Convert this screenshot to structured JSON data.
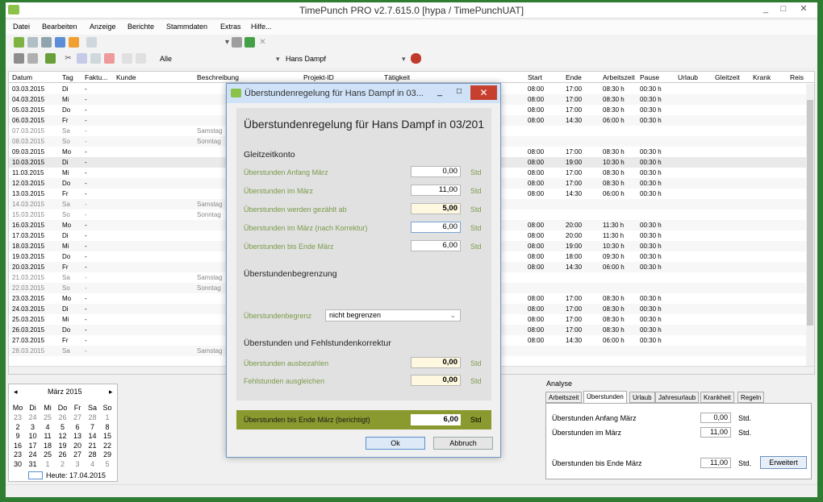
{
  "window": {
    "title": "TimePunch PRO v2.7.615.0 [hypa / TimePunchUAT]",
    "min": "_",
    "max": "□",
    "close": "✕"
  },
  "menu": [
    "Datei",
    "Bearbeiten",
    "Anzeige",
    "Berichte",
    "Stammdaten",
    "Extras",
    "Hilfe..."
  ],
  "toolbar2": {
    "filter": "Alle",
    "user": "Hans Dampf"
  },
  "grid": {
    "headers": [
      "Datum",
      "Tag",
      "Faktu...",
      "Kunde",
      "Beschreibung",
      "Projekt-ID",
      "Tätigkeit",
      "Start",
      "Ende",
      "Arbeitszeit",
      "Pause",
      "Urlaub",
      "Gleitzeit",
      "Krank",
      "Reis"
    ],
    "rows": [
      [
        "03.03.2015",
        "Di",
        "-",
        "",
        "",
        "08:00",
        "17:00",
        "08:30 h",
        "00:30 h"
      ],
      [
        "04.03.2015",
        "Mi",
        "-",
        "",
        "",
        "08:00",
        "17:00",
        "08:30 h",
        "00:30 h"
      ],
      [
        "05.03.2015",
        "Do",
        "-",
        "",
        "",
        "08:00",
        "17:00",
        "08:30 h",
        "00:30 h"
      ],
      [
        "06.03.2015",
        "Fr",
        "-",
        "",
        "",
        "08:00",
        "14:30",
        "06:00 h",
        "00:30 h"
      ],
      [
        "07.03.2015",
        "Sa",
        "-",
        "",
        "Samstag",
        "",
        "",
        "",
        ""
      ],
      [
        "08.03.2015",
        "So",
        "-",
        "",
        "Sonntag",
        "",
        "",
        "",
        ""
      ],
      [
        "09.03.2015",
        "Mo",
        "-",
        "",
        "",
        "08:00",
        "17:00",
        "08:30 h",
        "00:30 h"
      ],
      [
        "10.03.2015",
        "Di",
        "-",
        "",
        "",
        "08:00",
        "19:00",
        "10:30 h",
        "00:30 h"
      ],
      [
        "11.03.2015",
        "Mi",
        "-",
        "",
        "",
        "08:00",
        "17:00",
        "08:30 h",
        "00:30 h"
      ],
      [
        "12.03.2015",
        "Do",
        "-",
        "",
        "",
        "08:00",
        "17:00",
        "08:30 h",
        "00:30 h"
      ],
      [
        "13.03.2015",
        "Fr",
        "-",
        "",
        "",
        "08:00",
        "14:30",
        "06:00 h",
        "00:30 h"
      ],
      [
        "14.03.2015",
        "Sa",
        "-",
        "",
        "Samstag",
        "",
        "",
        "",
        ""
      ],
      [
        "15.03.2015",
        "So",
        "-",
        "",
        "Sonntag",
        "",
        "",
        "",
        ""
      ],
      [
        "16.03.2015",
        "Mo",
        "-",
        "",
        "",
        "08:00",
        "20:00",
        "11:30 h",
        "00:30 h"
      ],
      [
        "17.03.2015",
        "Di",
        "-",
        "",
        "",
        "08:00",
        "20:00",
        "11:30 h",
        "00:30 h"
      ],
      [
        "18.03.2015",
        "Mi",
        "-",
        "",
        "",
        "08:00",
        "19:00",
        "10:30 h",
        "00:30 h"
      ],
      [
        "19.03.2015",
        "Do",
        "-",
        "",
        "",
        "08:00",
        "18:00",
        "09:30 h",
        "00:30 h"
      ],
      [
        "20.03.2015",
        "Fr",
        "-",
        "",
        "",
        "08:00",
        "14:30",
        "06:00 h",
        "00:30 h"
      ],
      [
        "21.03.2015",
        "Sa",
        "-",
        "",
        "Samstag",
        "",
        "",
        "",
        ""
      ],
      [
        "22.03.2015",
        "So",
        "-",
        "",
        "Sonntag",
        "",
        "",
        "",
        ""
      ],
      [
        "23.03.2015",
        "Mo",
        "-",
        "",
        "",
        "08:00",
        "17:00",
        "08:30 h",
        "00:30 h"
      ],
      [
        "24.03.2015",
        "Di",
        "-",
        "",
        "",
        "08:00",
        "17:00",
        "08:30 h",
        "00:30 h"
      ],
      [
        "25.03.2015",
        "Mi",
        "-",
        "",
        "",
        "08:00",
        "17:00",
        "08:30 h",
        "00:30 h"
      ],
      [
        "26.03.2015",
        "Do",
        "-",
        "",
        "",
        "08:00",
        "17:00",
        "08:30 h",
        "00:30 h"
      ],
      [
        "27.03.2015",
        "Fr",
        "-",
        "",
        "",
        "08:00",
        "14:30",
        "06:00 h",
        "00:30 h"
      ],
      [
        "28.03.2015",
        "Sa",
        "-",
        "",
        "Samstag",
        "",
        "",
        "",
        ""
      ]
    ]
  },
  "calendar": {
    "title": "März 2015",
    "prev": "◂",
    "next": "▸",
    "weekdays": [
      "Mo",
      "Di",
      "Mi",
      "Do",
      "Fr",
      "Sa",
      "So"
    ],
    "weeks": [
      [
        "23",
        "24",
        "25",
        "26",
        "27",
        "28",
        "1"
      ],
      [
        "2",
        "3",
        "4",
        "5",
        "6",
        "7",
        "8"
      ],
      [
        "9",
        "10",
        "11",
        "12",
        "13",
        "14",
        "15"
      ],
      [
        "16",
        "17",
        "18",
        "19",
        "20",
        "21",
        "22"
      ],
      [
        "23",
        "24",
        "25",
        "26",
        "27",
        "28",
        "29"
      ],
      [
        "30",
        "31",
        "1",
        "2",
        "3",
        "4",
        "5"
      ]
    ],
    "today": "Heute: 17.04.2015"
  },
  "analyse": {
    "label": "Analyse",
    "tabs": [
      "Arbeitszeit",
      "Überstunden",
      "Urlaub",
      "Jahresurlaub",
      "Krankheit",
      "Regeln"
    ],
    "rows": [
      {
        "label": "Überstunden Anfang März",
        "value": "0,00",
        "unit": "Std."
      },
      {
        "label": "Überstunden im März",
        "value": "11,00",
        "unit": "Std."
      },
      {
        "label": "Überstunden bis Ende März",
        "value": "11,00",
        "unit": "Std."
      }
    ],
    "button": "Erweitert"
  },
  "dialog": {
    "title": "Überstundenregelung für Hans Dampf in 03...",
    "heading": "Überstundenregelung für Hans Dampf in 03/201",
    "sec1": "Gleitzeitkonto",
    "rows": [
      {
        "label": "Überstunden Anfang März",
        "value": "0,00",
        "unit": "Std"
      },
      {
        "label": "Überstunden im März",
        "value": "11,00",
        "unit": "Std"
      },
      {
        "label": "Überstunden werden gezählt ab",
        "value": "5,00",
        "unit": "Std"
      },
      {
        "label": "Überstunden im März (nach Korrektur)",
        "value": "6,00",
        "unit": "Std"
      },
      {
        "label": "Überstunden bis Ende März",
        "value": "6,00",
        "unit": "Std"
      }
    ],
    "sec2": "Überstundenbegrenzung",
    "limit_label": "Überstundenbegrenz",
    "limit_value": "nicht begrenzen",
    "sec3": "Überstunden und Fehlstundenkorrektur",
    "rows2": [
      {
        "label": "Überstunden ausbezahlen",
        "value": "0,00",
        "unit": "Std"
      },
      {
        "label": "Fehlstunden ausgleichen",
        "value": "0,00",
        "unit": "Std"
      }
    ],
    "footer": {
      "label": "Überstunden bis Ende März (berichtigt)",
      "value": "6,00",
      "unit": "Std"
    },
    "ok": "Ok",
    "cancel": "Abbruch"
  }
}
